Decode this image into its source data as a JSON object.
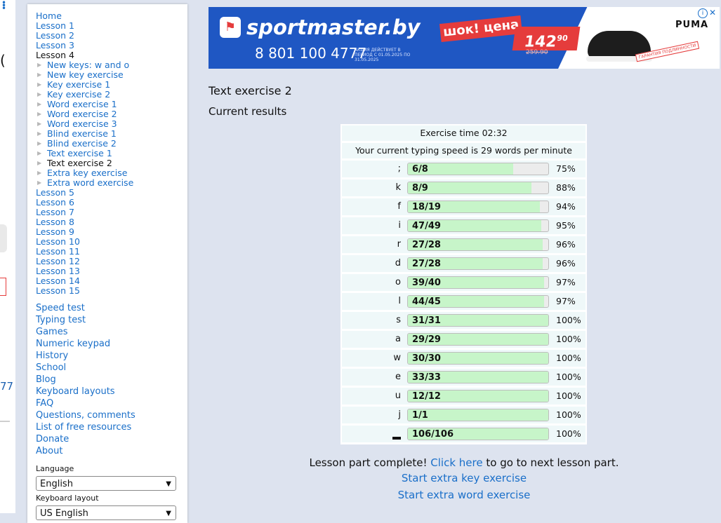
{
  "left_ad_strip": {
    "fragment_text": "77"
  },
  "nav": {
    "home": "Home",
    "lessons_before": [
      "Lesson 1",
      "Lesson 2",
      "Lesson 3"
    ],
    "current_lesson": "Lesson 4",
    "lesson4_items": [
      {
        "label": "New keys: w and o",
        "current": false
      },
      {
        "label": "New key exercise",
        "current": false
      },
      {
        "label": "Key exercise 1",
        "current": false
      },
      {
        "label": "Key exercise 2",
        "current": false
      },
      {
        "label": "Word exercise 1",
        "current": false
      },
      {
        "label": "Word exercise 2",
        "current": false
      },
      {
        "label": "Word exercise 3",
        "current": false
      },
      {
        "label": "Blind exercise 1",
        "current": false
      },
      {
        "label": "Blind exercise 2",
        "current": false
      },
      {
        "label": "Text exercise 1",
        "current": false
      },
      {
        "label": "Text exercise 2",
        "current": true
      },
      {
        "label": "Extra key exercise",
        "current": false
      },
      {
        "label": "Extra word exercise",
        "current": false
      }
    ],
    "lessons_after": [
      "Lesson 5",
      "Lesson 6",
      "Lesson 7",
      "Lesson 8",
      "Lesson 9",
      "Lesson 10",
      "Lesson 11",
      "Lesson 12",
      "Lesson 13",
      "Lesson 14",
      "Lesson 15"
    ],
    "tools": [
      "Speed test",
      "Typing test",
      "Games",
      "Numeric keypad",
      "History",
      "School",
      "Blog",
      "Keyboard layouts",
      "FAQ",
      "Questions, comments",
      "List of free resources",
      "Donate",
      "About"
    ]
  },
  "settings": {
    "language_label": "Language",
    "language_value": "English",
    "layout_label": "Keyboard layout",
    "layout_value": "US English"
  },
  "ad": {
    "brand": "sportmaster.by",
    "phone": "8 801 100 4777",
    "fine_print": "АКЦИЯ ДЕЙСТВУЕТ В ПЕРИОД С 01.05.2025 ПО 31.05.2025",
    "promo": "шок! цена",
    "price_main": "142",
    "price_cents": "90",
    "old_price": "259.90",
    "guarantee": "ГАРАНТИЯ ПОДЛИННОСТИ",
    "partner": "PUMA"
  },
  "page": {
    "title": "Text exercise 2",
    "results_heading": "Current results"
  },
  "results": {
    "exercise_time": "Exercise time 02:32",
    "speed": "Your current typing speed is 29 words per minute",
    "colors": {
      "fill": "#c7f5c9",
      "track": "#ececec"
    },
    "rows": [
      {
        "key": ";",
        "count": "6/8",
        "pct": "75%",
        "ratio": 0.75
      },
      {
        "key": "k",
        "count": "8/9",
        "pct": "88%",
        "ratio": 0.88
      },
      {
        "key": "f",
        "count": "18/19",
        "pct": "94%",
        "ratio": 0.94
      },
      {
        "key": "i",
        "count": "47/49",
        "pct": "95%",
        "ratio": 0.95
      },
      {
        "key": "r",
        "count": "27/28",
        "pct": "96%",
        "ratio": 0.96
      },
      {
        "key": "d",
        "count": "27/28",
        "pct": "96%",
        "ratio": 0.96
      },
      {
        "key": "o",
        "count": "39/40",
        "pct": "97%",
        "ratio": 0.97
      },
      {
        "key": "l",
        "count": "44/45",
        "pct": "97%",
        "ratio": 0.97
      },
      {
        "key": "s",
        "count": "31/31",
        "pct": "100%",
        "ratio": 1.0
      },
      {
        "key": "a",
        "count": "29/29",
        "pct": "100%",
        "ratio": 1.0
      },
      {
        "key": "w",
        "count": "30/30",
        "pct": "100%",
        "ratio": 1.0
      },
      {
        "key": "e",
        "count": "33/33",
        "pct": "100%",
        "ratio": 1.0
      },
      {
        "key": "u",
        "count": "12/12",
        "pct": "100%",
        "ratio": 1.0
      },
      {
        "key": "j",
        "count": "1/1",
        "pct": "100%",
        "ratio": 1.0
      },
      {
        "key": "space",
        "count": "106/106",
        "pct": "100%",
        "ratio": 1.0
      }
    ]
  },
  "footer": {
    "complete_prefix": "Lesson part complete!",
    "click_here": "Click here",
    "complete_suffix": "to go to next lesson part.",
    "extra_key": "Start extra key exercise",
    "extra_word": "Start extra word exercise"
  }
}
